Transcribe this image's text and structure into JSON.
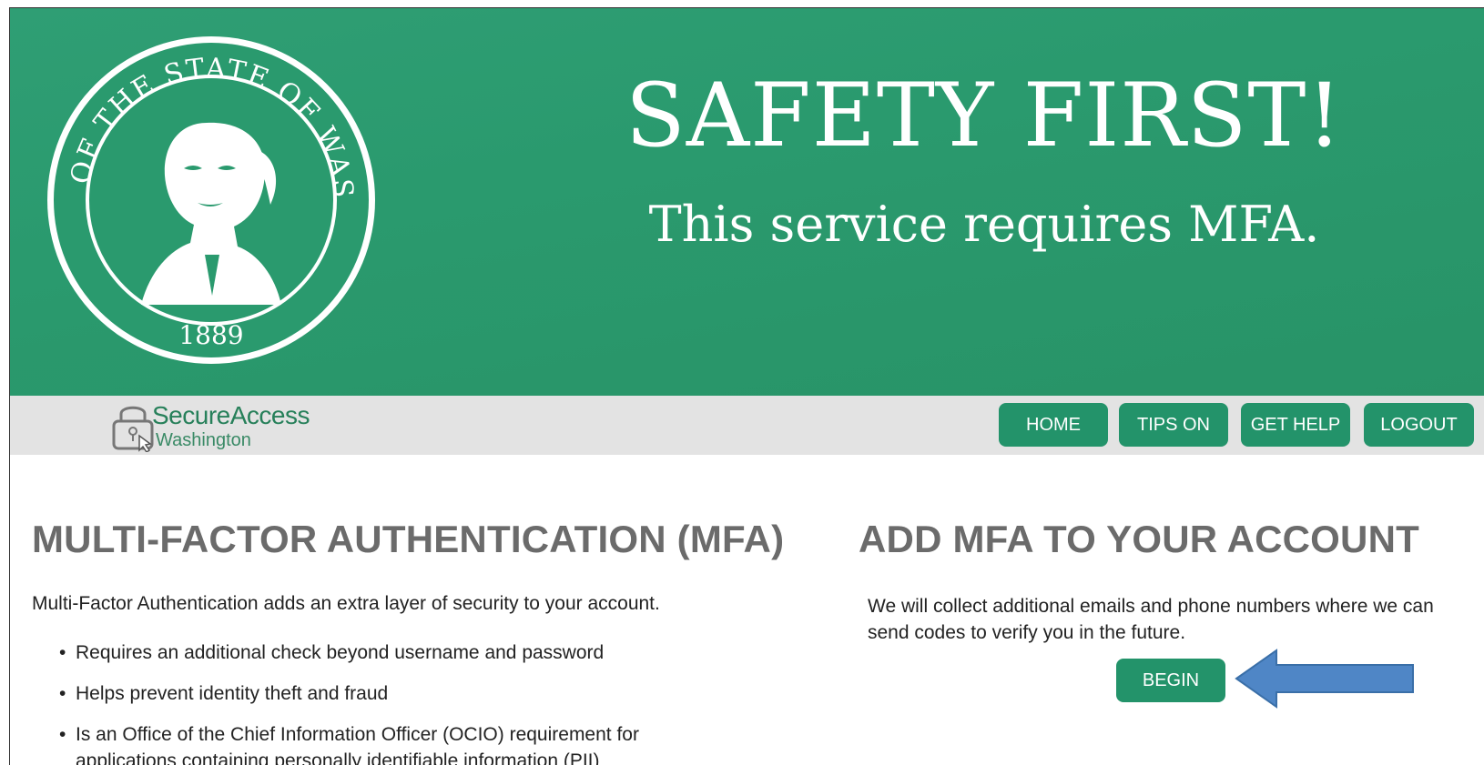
{
  "banner": {
    "headline": "SAFETY FIRST!",
    "subline": "This service requires MFA.",
    "seal": {
      "top_text": "THE SEAL OF THE STATE OF WASHINGTON",
      "year": "1889"
    }
  },
  "logo": {
    "secure": "SecureAccess",
    "washington": "Washington"
  },
  "nav": {
    "home": "HOME",
    "tips": "TIPS ON",
    "help": "GET HELP",
    "logout": "LOGOUT"
  },
  "left": {
    "heading": "MULTI-FACTOR AUTHENTICATION (MFA)",
    "intro": "Multi-Factor Authentication adds an extra layer of security to your account.",
    "bullets": [
      "Requires an additional check beyond username and password",
      "Helps prevent identity theft and fraud",
      "Is an Office of the Chief Information Officer (OCIO) requirement for applications containing personally identifiable information (PII)"
    ]
  },
  "right": {
    "heading": "ADD MFA TO YOUR ACCOUNT",
    "text": "We will collect additional emails and phone numbers where we can send codes to verify you in the future.",
    "begin": "BEGIN"
  },
  "colors": {
    "brand_green": "#23936a",
    "banner_green": "#2a9a6e",
    "heading_gray": "#6b6b6b",
    "navbar_gray": "#e3e3e3",
    "arrow_blue": "#4f86c6"
  },
  "icons": {
    "seal": "washington-state-seal-icon",
    "lock": "lock-icon",
    "arrow": "left-arrow-annotation-icon"
  }
}
